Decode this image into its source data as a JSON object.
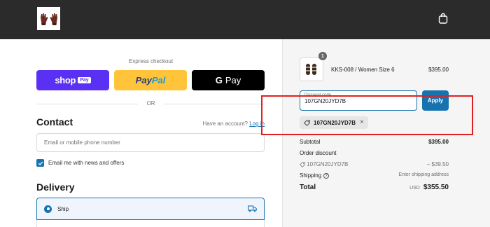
{
  "header": {
    "logo": "gloves-logo",
    "cart_icon": "shopping-bag-icon"
  },
  "express": {
    "label": "Express checkout",
    "shop_word": "shop",
    "shop_chip": "Pay",
    "paypal_word_1": "Pay",
    "paypal_word_2": "Pal",
    "gpay_g": "G",
    "gpay_word": "Pay",
    "divider": "OR"
  },
  "contact": {
    "title": "Contact",
    "have_account": "Have an account?",
    "login_link": "Log in",
    "email_placeholder": "Email or mobile phone number",
    "newsletter_label": "Email me with news and offers",
    "newsletter_checked": true
  },
  "delivery": {
    "title": "Delivery",
    "option_ship": "Ship",
    "option_icon": "truck-icon"
  },
  "summary": {
    "quantity": "1",
    "product_name": "KKS-008 / Women Size 6",
    "product_price": "$395.00",
    "discount_label": "Discount code",
    "discount_value": "107GN20JYD7B",
    "apply_label": "Apply",
    "applied_code": "107GN20JYD7B",
    "subtotal_label": "Subtotal",
    "subtotal_value": "$395.00",
    "order_discount_label": "Order discount",
    "discount_code_line": "107GN20JYD7B",
    "discount_amount": "− $39.50",
    "shipping_label": "Shipping",
    "shipping_value": "Enter shipping address",
    "total_label": "Total",
    "currency": "USD",
    "total_value": "$355.50"
  },
  "colors": {
    "header_bg": "#2b2b2b",
    "accent": "#1773b0",
    "shop_pay": "#5a31f4",
    "paypal": "#ffc439",
    "highlight": "#e02020"
  }
}
